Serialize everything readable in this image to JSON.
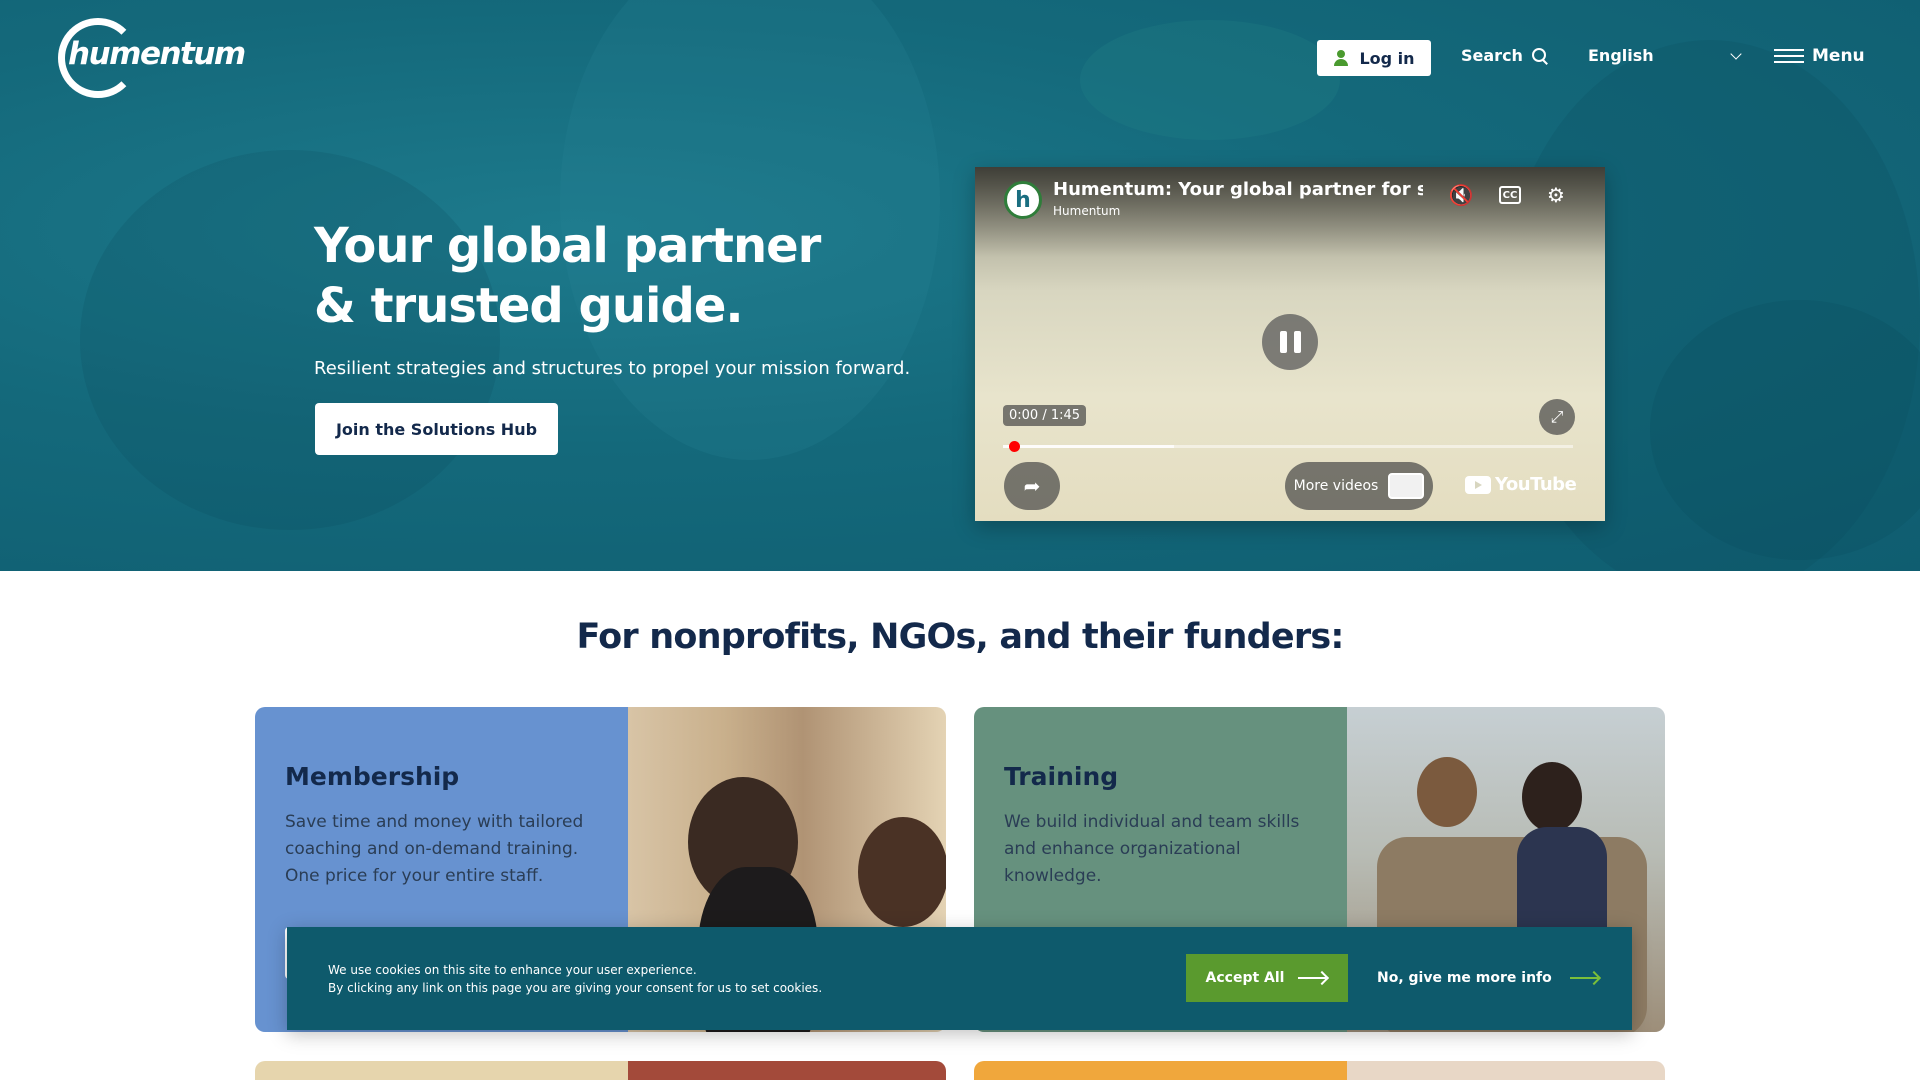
{
  "header": {
    "logo_text": "humentum",
    "login_label": "Log in",
    "search_label": "Search",
    "language": "English",
    "menu_label": "Menu"
  },
  "hero": {
    "title_line1": "Your global partner",
    "title_line2": "& trusted guide.",
    "subtitle": "Resilient strategies and structures to propel your mission forward.",
    "cta_label": "Join the Solutions Hub"
  },
  "video": {
    "avatar_letter": "h",
    "title": "Humentum: Your global partner for social",
    "channel": "Humentum",
    "time": "0:00 / 1:45",
    "progress": 0.01,
    "buffered": 0.3,
    "more_videos_label": "More videos",
    "youtube_label": "YouTube",
    "icons": [
      "mute-icon",
      "cc-icon",
      "settings-icon",
      "pause-icon",
      "fullscreen-icon",
      "share-icon"
    ]
  },
  "section": {
    "title": "For nonprofits, NGOs, and their funders:"
  },
  "cards": [
    {
      "title": "Membership",
      "text": "Save time and money with tailored coaching and on-demand training. One price for your entire staff.",
      "color": "#6792d0"
    },
    {
      "title": "Training",
      "text": "We build individual and team skills and enhance organizational knowledge.",
      "color": "#66917e"
    }
  ],
  "cookie": {
    "line1": "We use cookies on this site to enhance your user experience.",
    "line2": "By clicking any link on this page you are giving your consent for us to set cookies.",
    "accept_label": "Accept All",
    "more_info_label": "No, give me more info"
  },
  "colors": {
    "hero_bg": "#14697b",
    "navy": "#13294b",
    "green": "#5a9a2e",
    "cookie_bg": "#0e5a6c"
  }
}
